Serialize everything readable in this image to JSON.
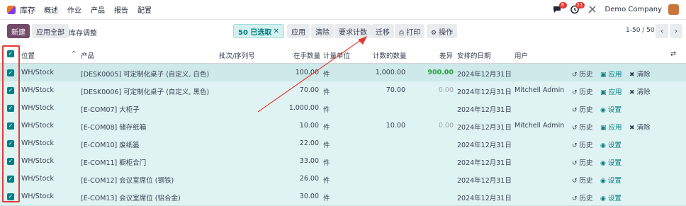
{
  "navbar": {
    "app": "库存",
    "menu": [
      "概述",
      "作业",
      "产品",
      "报告",
      "配置"
    ],
    "chat_badge": "6",
    "activity_badge": "21",
    "company": "Demo Company"
  },
  "control": {
    "new_label": "新建",
    "apply_all_label": "应用全部",
    "breadcrumb": "库存调整",
    "selected": "50 已选取",
    "actions": [
      "应用",
      "清除",
      "要求计数",
      "迁移",
      "打印",
      "操作"
    ],
    "pager": "1-50 / 50"
  },
  "columns": {
    "location": "位置",
    "product": "产品",
    "lot": "批次/序列号",
    "qty": "在手数量",
    "uom": "计量单位",
    "counted": "计数的数量",
    "diff": "差异",
    "date": "安排的日期",
    "user": "用户"
  },
  "rows": [
    {
      "location": "WH/Stock",
      "product": "[DESK0005] 可定制化桌子 (自定义, 白色)",
      "qty": "100.00",
      "uom": "件",
      "counted": "1,000.00",
      "diff": "900.00",
      "date": "2024年12月31日",
      "user": "",
      "actions": [
        "历史",
        "应用",
        "清除"
      ]
    },
    {
      "location": "WH/Stock",
      "product": "[DESK0006] 可定制化桌子 (自定义, 黑色)",
      "qty": "70.00",
      "uom": "件",
      "counted": "70.00",
      "diff": "0.00",
      "date": "2024年12月31日",
      "user": "Mitchell Admin",
      "actions": [
        "历史",
        "应用",
        "清除"
      ]
    },
    {
      "location": "WH/Stock",
      "product": "[E-COM07] 大柜子",
      "qty": "1,000.00",
      "uom": "件",
      "counted": "",
      "diff": "",
      "date": "2024年12月31日",
      "user": "",
      "actions": [
        "历史",
        "设置"
      ]
    },
    {
      "location": "WH/Stock",
      "product": "[E-COM08] 储存纸箱",
      "qty": "10.00",
      "uom": "件",
      "counted": "10.00",
      "diff": "0.00",
      "date": "2024年12月31日",
      "user": "Mitchell Admin",
      "actions": [
        "历史",
        "应用",
        "清除"
      ]
    },
    {
      "location": "WH/Stock",
      "product": "[E-COM10] 废纸篓",
      "qty": "22.00",
      "uom": "件",
      "counted": "",
      "diff": "",
      "date": "2024年12月31日",
      "user": "",
      "actions": [
        "历史",
        "设置"
      ]
    },
    {
      "location": "WH/Stock",
      "product": "[E-COM11] 橱柜合门",
      "qty": "33.00",
      "uom": "件",
      "counted": "",
      "diff": "",
      "date": "2024年12月31日",
      "user": "",
      "actions": [
        "历史",
        "设置"
      ]
    },
    {
      "location": "WH/Stock",
      "product": "[E-COM12] 会议室席位 (钢铁)",
      "qty": "26.00",
      "uom": "件",
      "counted": "",
      "diff": "",
      "date": "2024年12月31日",
      "user": "",
      "actions": [
        "历史",
        "设置"
      ]
    },
    {
      "location": "WH/Stock",
      "product": "[E-COM13] 会议室席位 (铝合金)",
      "qty": "30.00",
      "uom": "件",
      "counted": "",
      "diff": "",
      "date": "2024年12月31日",
      "user": "",
      "actions": [
        "历史",
        "设置"
      ]
    }
  ]
}
